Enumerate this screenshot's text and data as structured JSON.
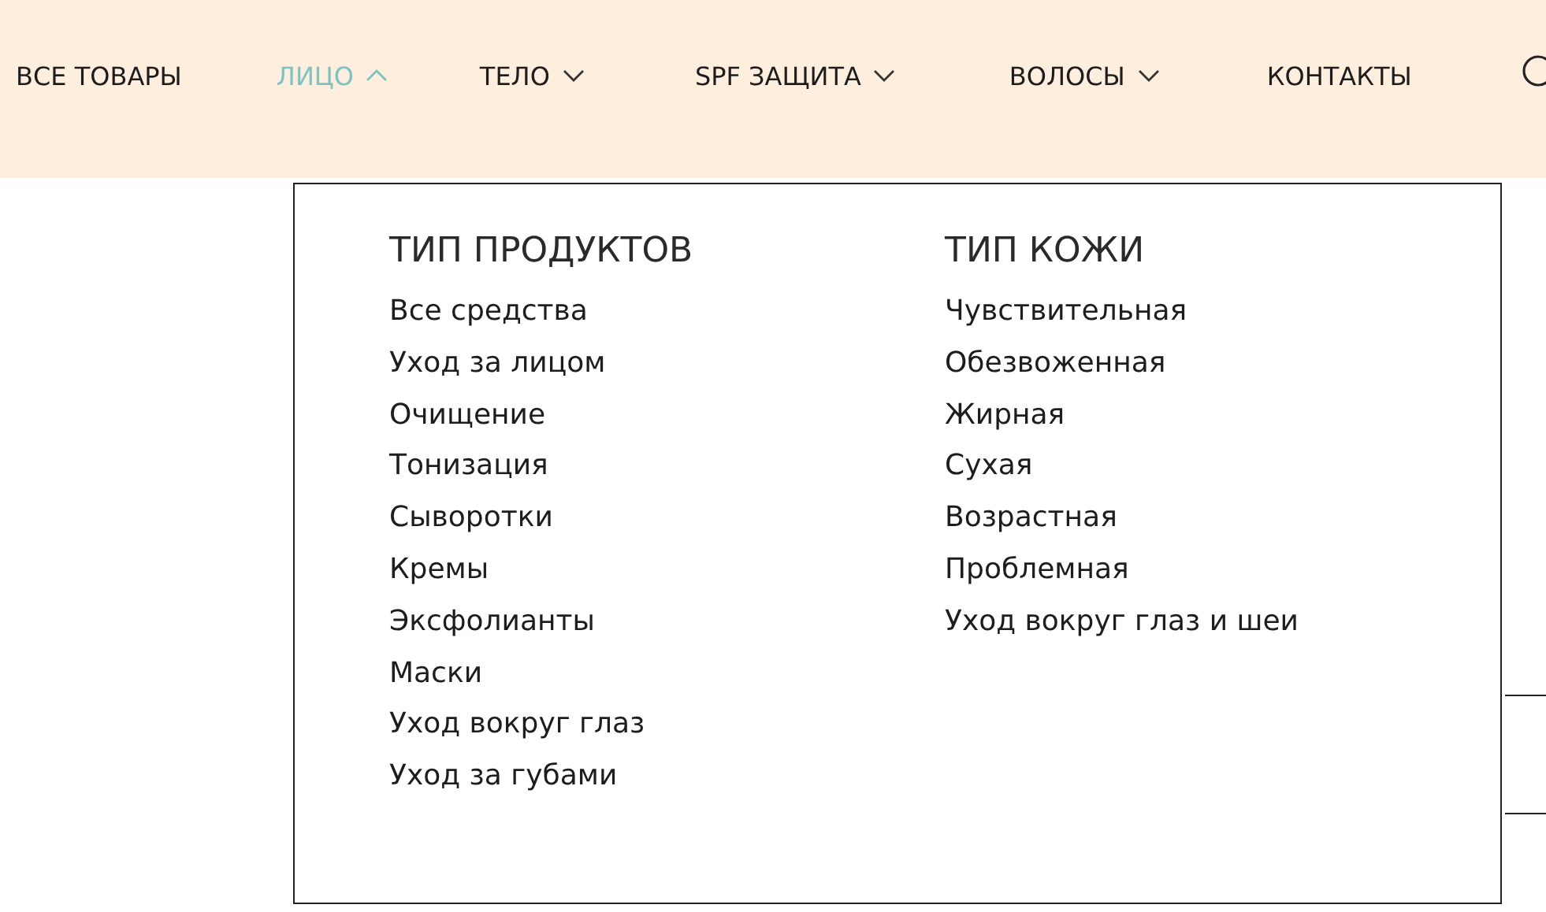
{
  "nav": {
    "items": [
      {
        "label": "ВСЕ ТОВАРЫ",
        "kind": "link",
        "selected": false
      },
      {
        "label": "ЛИЦО",
        "kind": "dropdown",
        "selected": true,
        "expanded": true
      },
      {
        "label": "ТЕЛО",
        "kind": "dropdown",
        "selected": false,
        "expanded": false
      },
      {
        "label": "SPF ЗАЩИТА",
        "kind": "dropdown",
        "selected": false,
        "expanded": false
      },
      {
        "label": "ВОЛОСЫ",
        "kind": "dropdown",
        "selected": false,
        "expanded": false
      },
      {
        "label": "КОНТАКТЫ",
        "kind": "link",
        "selected": false
      }
    ]
  },
  "mega_menu": {
    "columns": [
      {
        "heading": "ТИП ПРОДУКТОВ",
        "links": [
          "Все средства",
          "Уход за лицом",
          "Очищение",
          "Тонизация",
          "Сыворотки",
          "Кремы",
          "Эксфолианты",
          "Маски",
          "Уход вокруг глаз",
          "Уход за губами"
        ]
      },
      {
        "heading": "ТИП КОЖИ",
        "links": [
          "Чувствительная",
          "Обезвоженная",
          "Жирная",
          "Сухая",
          "Возрастная",
          "Проблемная",
          "Уход вокруг глаз и шеи"
        ]
      }
    ]
  }
}
